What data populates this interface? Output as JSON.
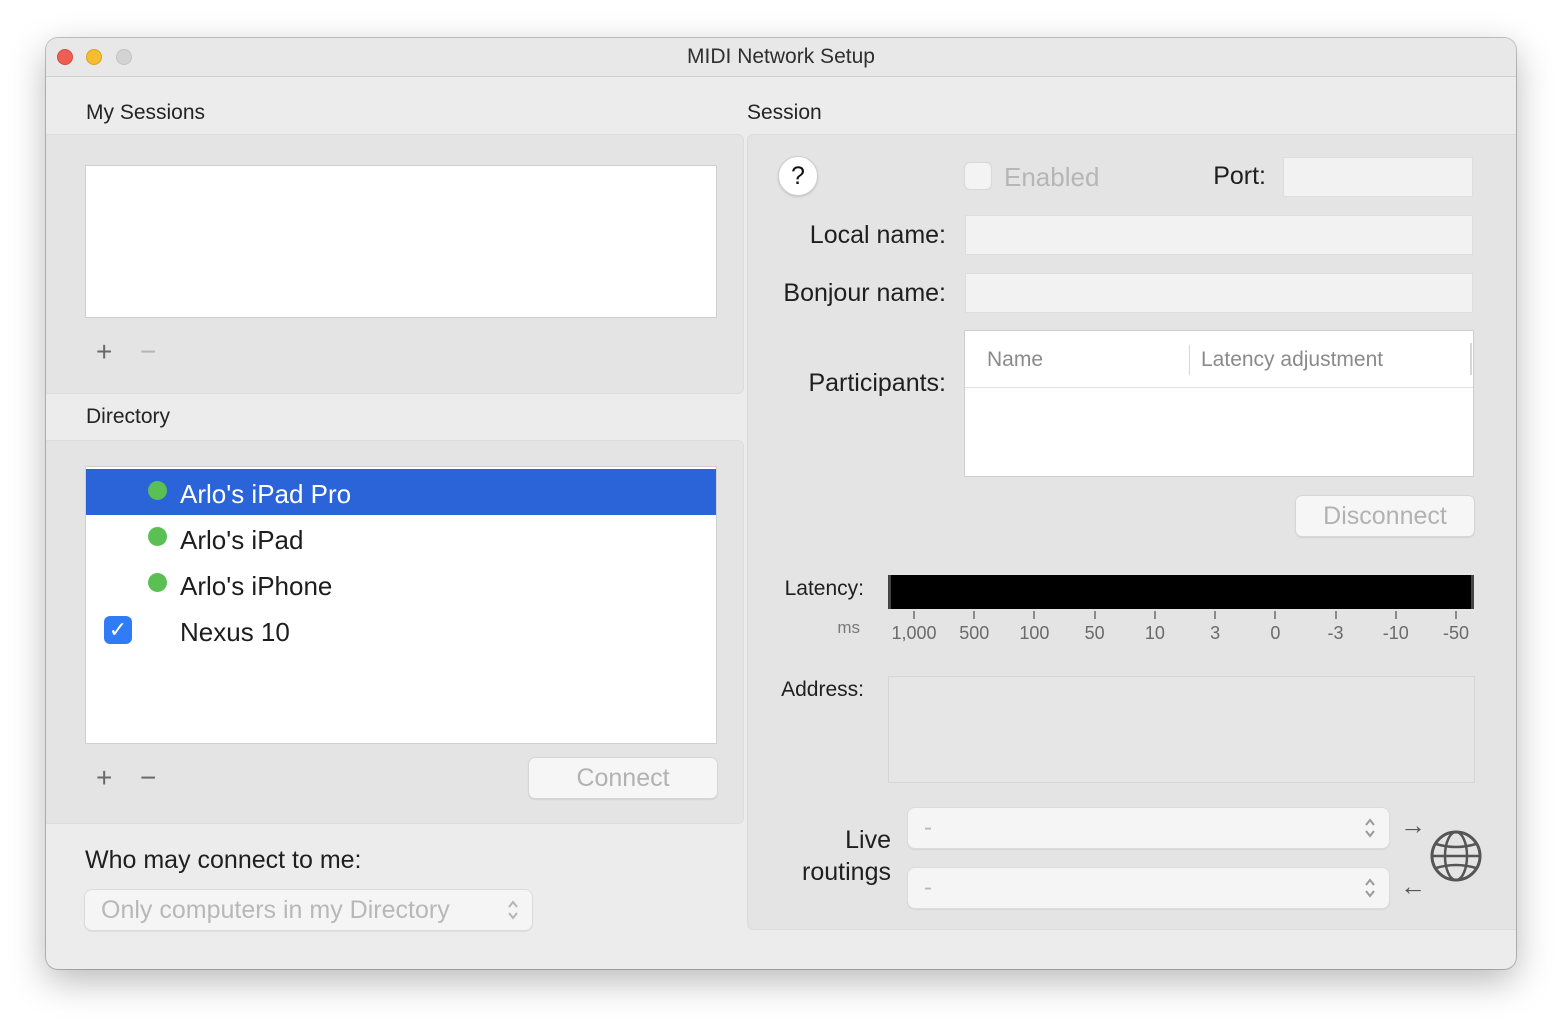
{
  "window": {
    "title": "MIDI Network Setup"
  },
  "my_sessions": {
    "label": "My Sessions",
    "add": "+",
    "remove": "−"
  },
  "directory": {
    "label": "Directory",
    "items": [
      {
        "name": "Arlo's iPad Pro",
        "status": "online",
        "selected": true
      },
      {
        "name": "Arlo's iPad",
        "status": "online",
        "selected": false
      },
      {
        "name": "Arlo's iPhone",
        "status": "online",
        "selected": false
      },
      {
        "name": "Nexus 10",
        "status": "checked",
        "selected": false
      }
    ],
    "add": "+",
    "remove": "−",
    "connect_label": "Connect"
  },
  "who_may_connect": {
    "label": "Who may connect to me:",
    "selected": "Only computers in my Directory"
  },
  "session": {
    "label": "Session",
    "help": "?",
    "enabled_label": "Enabled",
    "port_label": "Port:",
    "local_name_label": "Local name:",
    "bonjour_name_label": "Bonjour name:",
    "participants_label": "Participants:",
    "participants_columns": [
      "Name",
      "Latency adjustment"
    ],
    "disconnect_label": "Disconnect",
    "latency_label": "Latency:",
    "latency_unit": "ms",
    "latency_ticks": [
      "1,000",
      "500",
      "100",
      "50",
      "10",
      "3",
      "0",
      "-3",
      "-10",
      "-50"
    ],
    "address_label": "Address:",
    "live_routings_label_1": "Live",
    "live_routings_label_2": "routings",
    "routing_out_value": "-",
    "routing_in_value": "-",
    "arrow_out": "→",
    "arrow_in": "←"
  },
  "colors": {
    "selection": "#2b63d9",
    "status_online": "#5ac053",
    "checkbox": "#2f7cf6"
  }
}
